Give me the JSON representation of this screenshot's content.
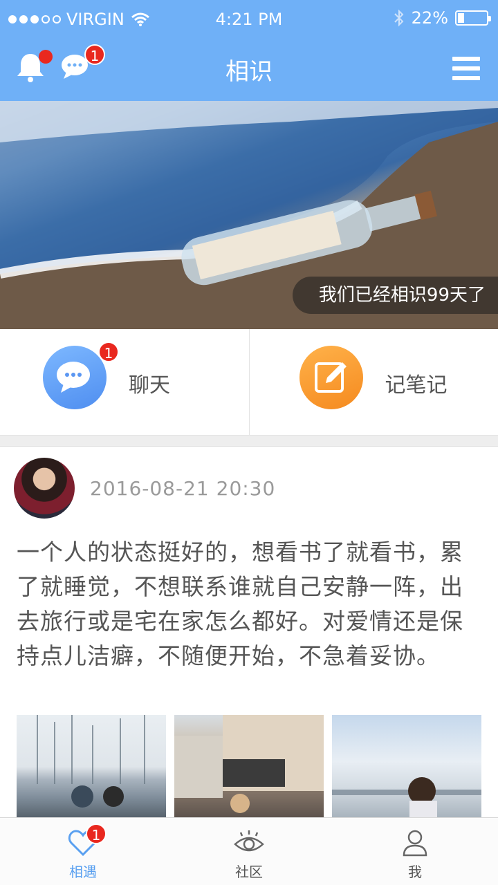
{
  "status_bar": {
    "carrier": "VIRGIN",
    "time": "4:21 PM",
    "battery": "22%",
    "battery_level": 0.22
  },
  "nav": {
    "title": "相识",
    "chat_badge": "1"
  },
  "banner": {
    "caption": "我们已经相识99天了"
  },
  "actions": {
    "chat_label": "聊天",
    "chat_badge": "1",
    "note_label": "记笔记"
  },
  "post": {
    "time": "2016-08-21   20:30",
    "text": "一个人的状态挺好的，想看书了就看书，累了就睡觉，不想联系谁就自己安静一阵，出去旅行或是宅在家怎么都好。对爱情还是保持点儿洁癖，不随便开始，不急着妥协。"
  },
  "tabs": [
    {
      "label": "相遇",
      "icon": "heart-icon",
      "badge": "1",
      "active": true
    },
    {
      "label": "社区",
      "icon": "eye-icon",
      "active": false
    },
    {
      "label": "我",
      "icon": "person-icon",
      "active": false
    }
  ],
  "colors": {
    "header": "#6fb0f7",
    "badge": "#e9281f",
    "chat_accent": "#4f8ef0",
    "note_accent": "#f58a1f",
    "active_tab": "#5aa0f0"
  }
}
